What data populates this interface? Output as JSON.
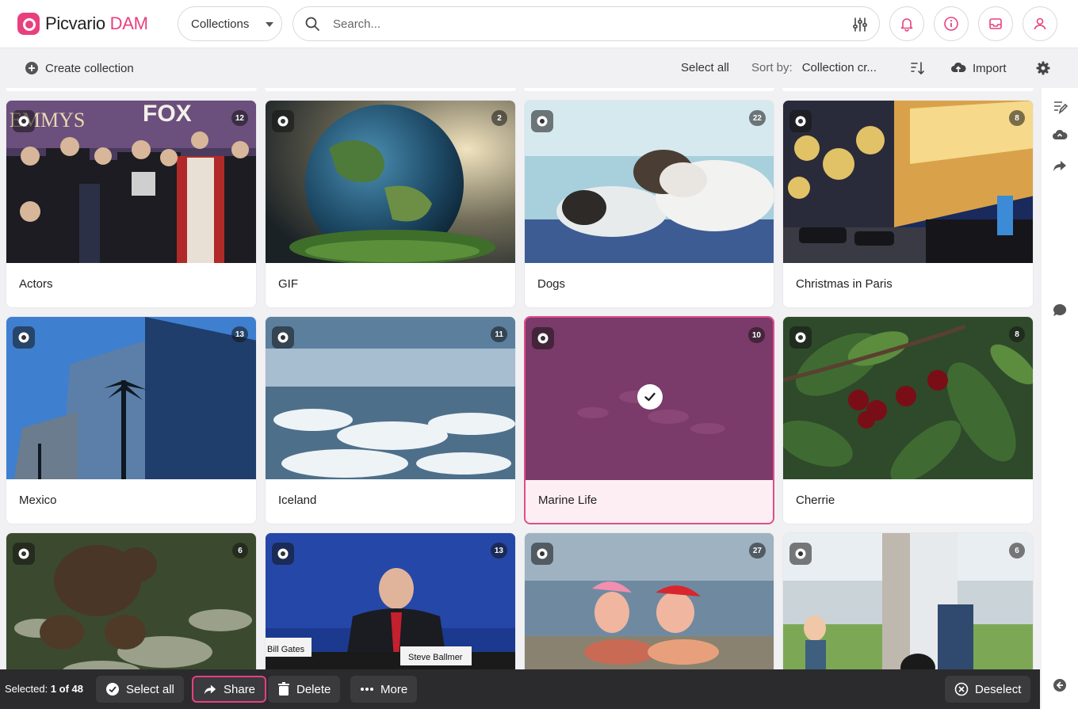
{
  "app": {
    "brand_main": "Picvario",
    "brand_accent": "DAM",
    "accent_color": "#e8407f"
  },
  "header": {
    "collections_select": "Collections",
    "search_placeholder": "Search...",
    "icons": [
      "search-icon",
      "filter-icon",
      "bell-icon",
      "info-icon",
      "inbox-icon",
      "user-icon"
    ]
  },
  "toolbar": {
    "create_collection": "Create collection",
    "select_all": "Select all",
    "sort_label": "Sort by:",
    "sort_value": "Collection cr...",
    "import": "Import"
  },
  "collections": [
    {
      "title": "Actors",
      "count": "12",
      "selected": false
    },
    {
      "title": "GIF",
      "count": "2",
      "selected": false
    },
    {
      "title": "Dogs",
      "count": "22",
      "selected": false
    },
    {
      "title": "Christmas in Paris",
      "count": "8",
      "selected": false
    },
    {
      "title": "Mexico",
      "count": "13",
      "selected": false
    },
    {
      "title": "Iceland",
      "count": "11",
      "selected": false
    },
    {
      "title": "Marine Life",
      "count": "10",
      "selected": true
    },
    {
      "title": "Cherrie",
      "count": "8",
      "selected": false
    },
    {
      "title": "",
      "count": "6",
      "selected": false
    },
    {
      "title": "",
      "count": "13",
      "selected": false
    },
    {
      "title": "",
      "count": "27",
      "selected": false
    },
    {
      "title": "",
      "count": "6",
      "selected": false
    }
  ],
  "thumb_text": {
    "emmys": "EMMYS",
    "fox": "FOX",
    "bill_gates": "Bill Gates",
    "steve_ballmer": "Steve Ballmer"
  },
  "selection_bar": {
    "selected_label": "Selected:",
    "selected_value": "1 of 48",
    "select_all": "Select all",
    "share": "Share",
    "delete": "Delete",
    "more": "More",
    "deselect": "Deselect"
  }
}
